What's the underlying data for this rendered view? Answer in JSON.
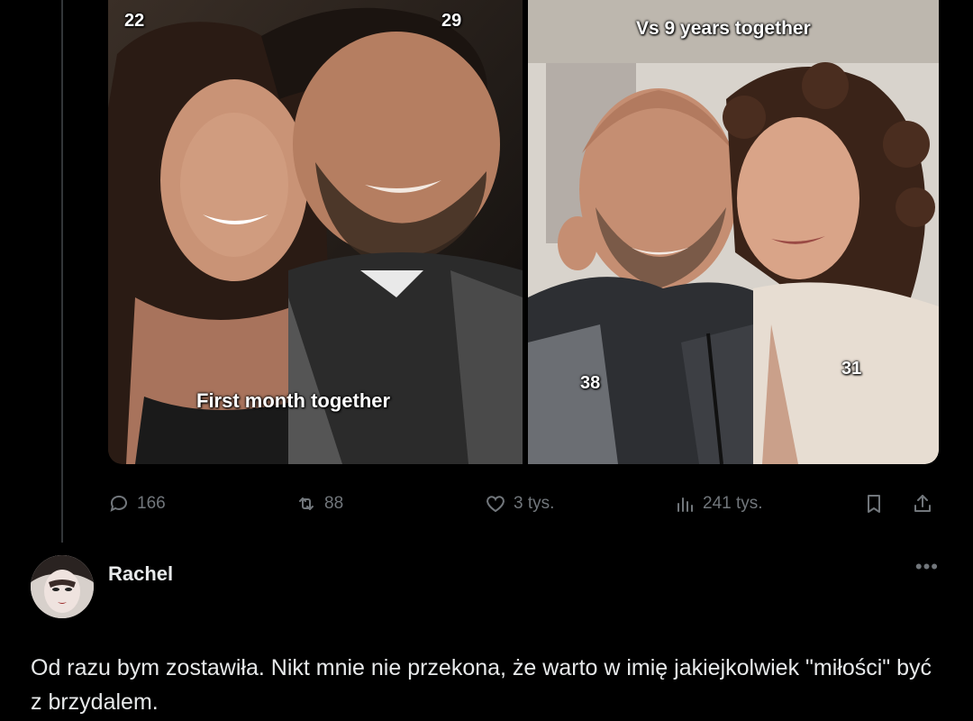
{
  "post": {
    "photo_left": {
      "age_left": "22",
      "age_right": "29",
      "caption": "First month together"
    },
    "photo_right": {
      "caption": "Vs 9 years together",
      "age_left": "38",
      "age_right": "31"
    },
    "actions": {
      "replies": "166",
      "reposts": "88",
      "likes": "3 tys.",
      "views": "241 tys."
    },
    "icons": {
      "replies": "reply-bubble-icon",
      "reposts": "repost-arrows-icon",
      "likes": "heart-icon",
      "views": "bar-chart-icon",
      "bookmark": "bookmark-icon",
      "share": "share-upload-icon"
    }
  },
  "reply": {
    "user_name": "Rachel",
    "more_label": "•••",
    "text": "Od razu bym zostawiła. Nikt mnie nie przekona, że warto w imię jakiejkolwiek \"miłości\" być z brzydalem."
  },
  "colors": {
    "background": "#000000",
    "text": "#e7e9ea",
    "muted": "#71767b"
  }
}
